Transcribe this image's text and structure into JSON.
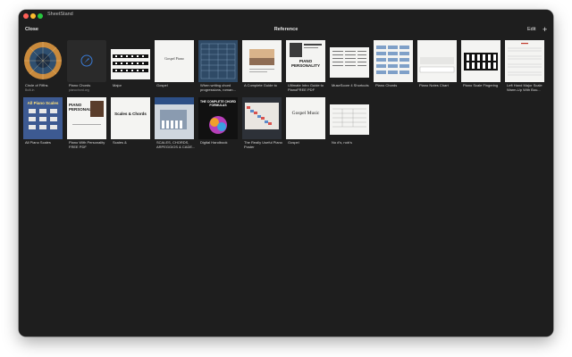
{
  "window": {
    "app_title": "SheetStand",
    "view_title": "Reference"
  },
  "toolbar": {
    "close_label": "Close",
    "edit_label": "Edit",
    "add_label": "+"
  },
  "items": [
    {
      "caption": "Circle of Fifths",
      "sub": "Built-in"
    },
    {
      "caption": "Piano Chords",
      "sub": "pianochord.org"
    },
    {
      "caption": "Major",
      "sub": ""
    },
    {
      "caption": "Gospel",
      "sub": "",
      "thumb_text": "Gospel Piano"
    },
    {
      "caption": "When writing chord progressions, roman...",
      "sub": ""
    },
    {
      "caption": "A Complete Guide to",
      "sub": ""
    },
    {
      "caption": "Ultimate Intro Guide to PianoFREE PDF",
      "sub": "",
      "thumb_text": "PIANO PERSONALITY"
    },
    {
      "caption": "MuseScore 4 Shortcuts",
      "sub": ""
    },
    {
      "caption": "Piano Chords",
      "sub": ""
    },
    {
      "caption": "Piano Notes Chart",
      "sub": ""
    },
    {
      "caption": "Piano Scale Fingering",
      "sub": ""
    },
    {
      "caption": "Left Hand Major Scale Warm-Up With Bou...",
      "sub": ""
    },
    {
      "caption": "All Piano Scales",
      "sub": "",
      "thumb_text": "All Piano Scales"
    },
    {
      "caption": "Piano With Personality FREE PDF",
      "sub": "",
      "thumb_text": "PIANO PERSONALITY"
    },
    {
      "caption": "Scales &",
      "sub": "",
      "thumb_text": "Scales & Chords"
    },
    {
      "caption": "SCALES, CHORDS, ARPEGGIOS & CADE...",
      "sub": ""
    },
    {
      "caption": "Digital Handbook",
      "sub": "",
      "thumb_text": "THE COMPLETE CHORD FORMULAS"
    },
    {
      "caption": "The Really Useful Piano Poster",
      "sub": ""
    },
    {
      "caption": "Gospel",
      "sub": "",
      "thumb_text": "Gospel Music"
    },
    {
      "caption": "No #'s, nob's",
      "sub": ""
    }
  ]
}
